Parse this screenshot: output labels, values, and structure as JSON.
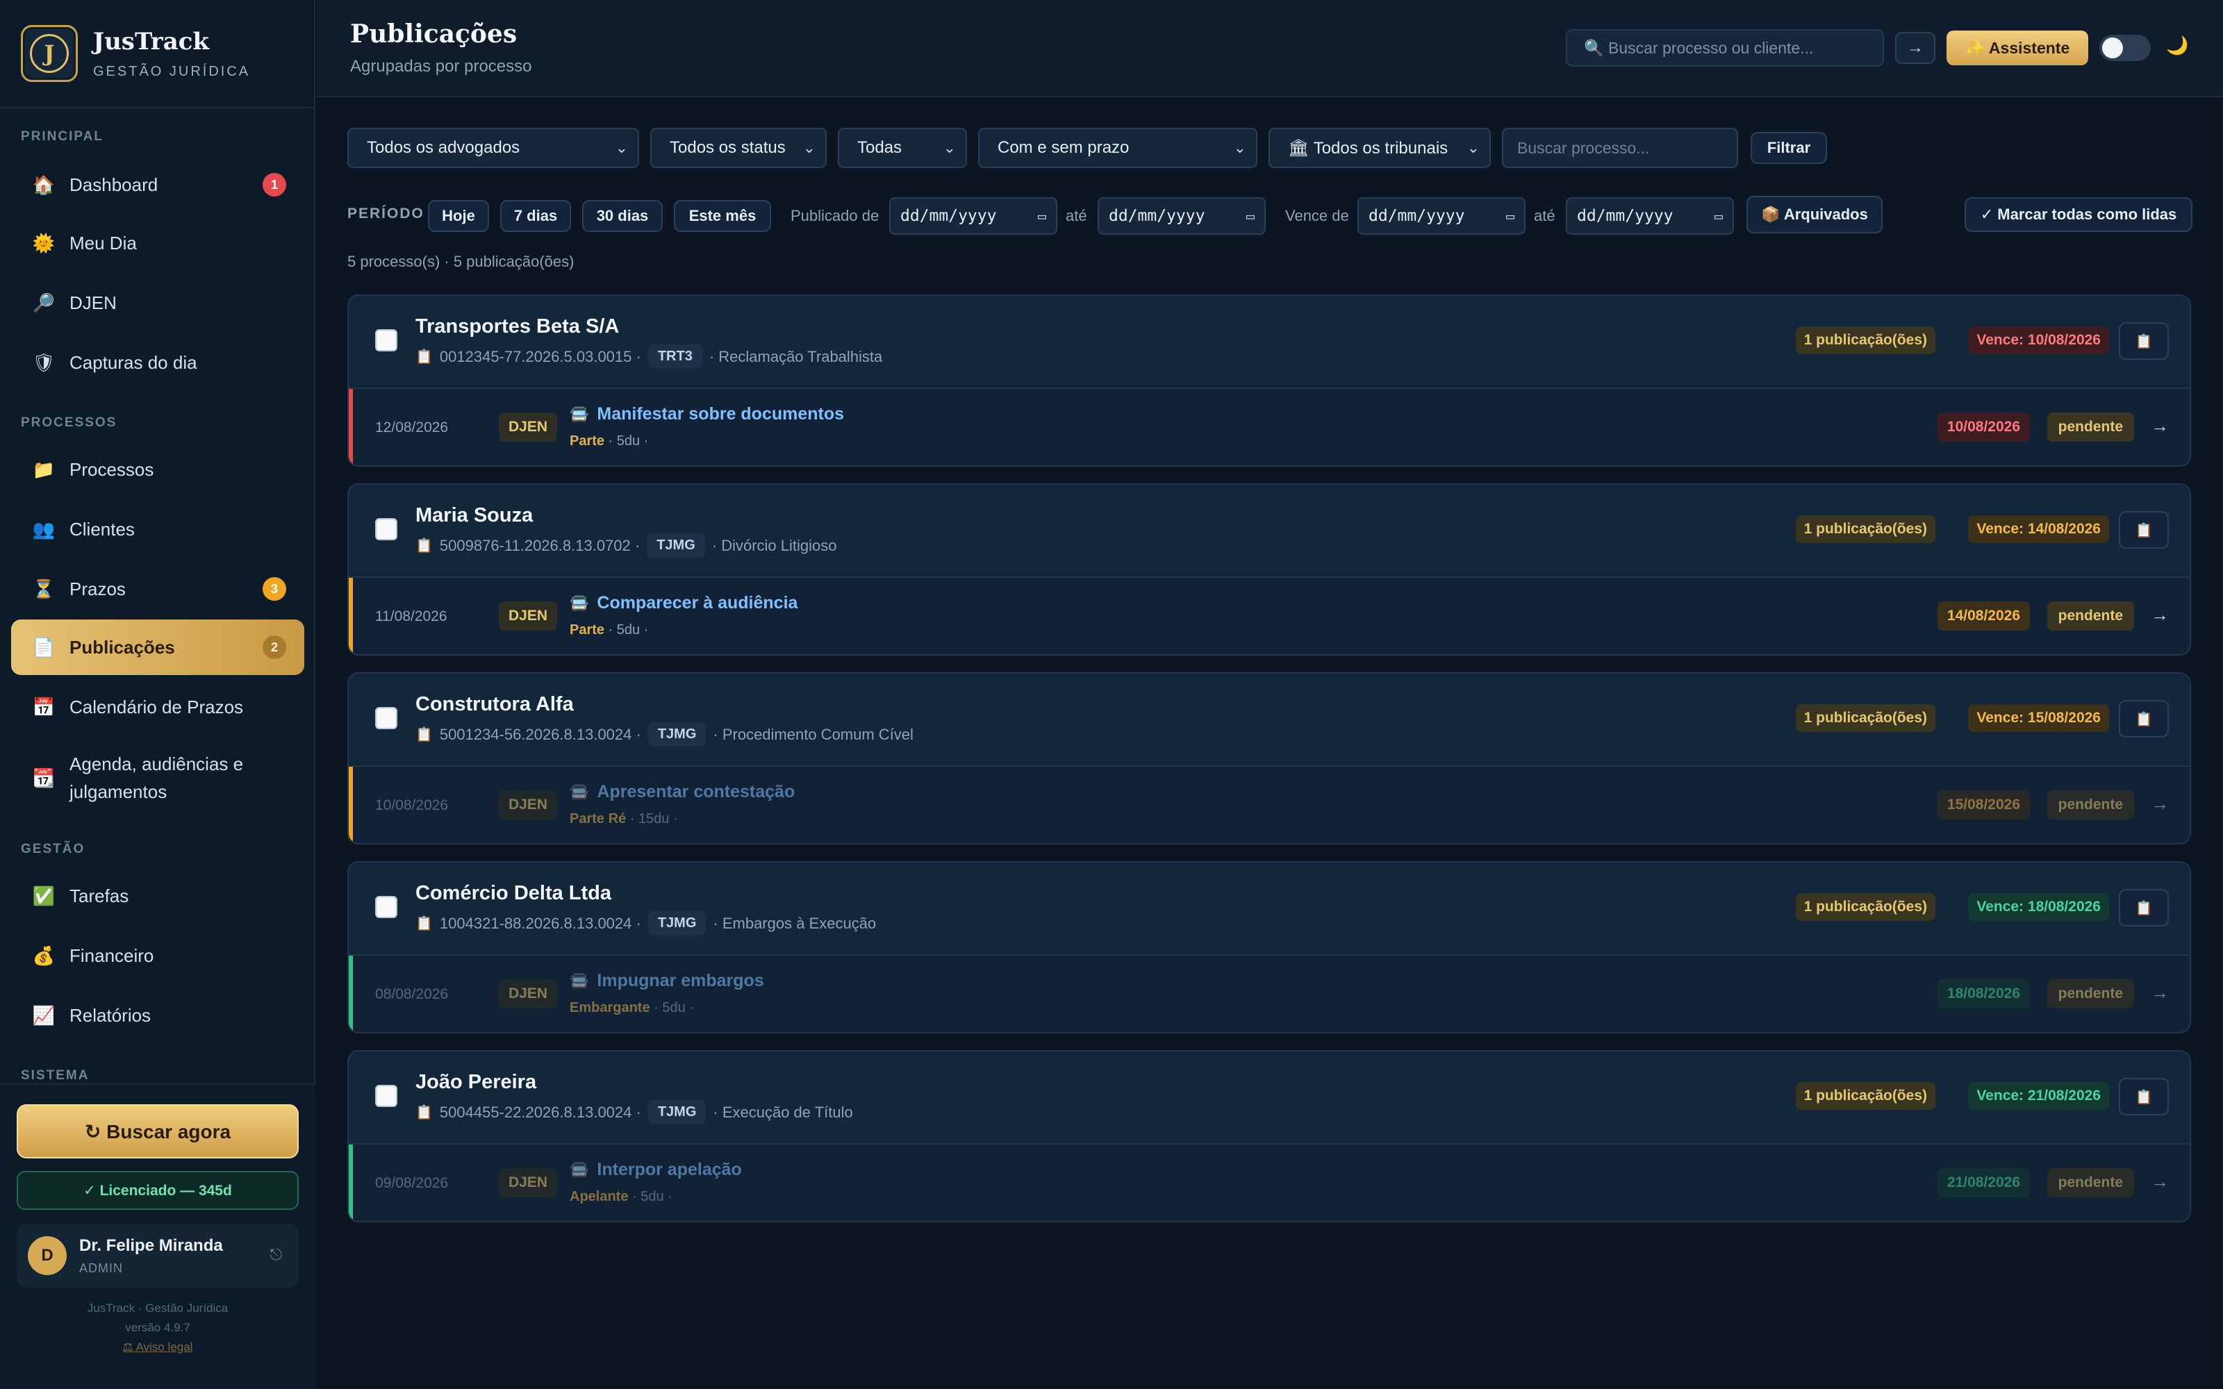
{
  "app": {
    "name": "JusTrack",
    "subtitle": "GESTÃO JURÍDICA",
    "logo_letter": "J"
  },
  "sidebar": {
    "sections": [
      {
        "label": "PRINCIPAL"
      },
      {
        "label": "PROCESSOS"
      },
      {
        "label": "GESTÃO"
      },
      {
        "label": "SISTEMA"
      }
    ],
    "items": [
      {
        "label": "Dashboard",
        "icon": "🏠",
        "badge": "1"
      },
      {
        "label": "Meu Dia",
        "icon": "🌞"
      },
      {
        "label": "DJEN",
        "icon": "🔎"
      },
      {
        "label": "Capturas do dia",
        "icon": "🛡"
      },
      {
        "label": "Processos",
        "icon": "📁"
      },
      {
        "label": "Clientes",
        "icon": "👥"
      },
      {
        "label": "Prazos",
        "icon": "⏳",
        "badge": "3"
      },
      {
        "label": "Publicações",
        "icon": "📄",
        "badge": "2"
      },
      {
        "label": "Calendário de Prazos",
        "icon": "📅"
      },
      {
        "label": "Agenda, audiências e julgamentos",
        "icon": "📆"
      },
      {
        "label": "Tarefas",
        "icon": "✅"
      },
      {
        "label": "Financeiro",
        "icon": "💰"
      },
      {
        "label": "Relatórios",
        "icon": "📈"
      }
    ],
    "search_button": "↻  Buscar agora",
    "license": "✓ Licenciado — 345d",
    "user": {
      "initial": "D",
      "name": "Dr. Felipe Miranda",
      "role": "ADMIN",
      "logout_icon": "⎋"
    },
    "footer": {
      "line1": "JusTrack · Gestão Jurídica",
      "line2": "versão 4.9.7",
      "legal": "⚖ Aviso legal"
    }
  },
  "header": {
    "title": "Publicações",
    "subtitle": "Agrupadas por processo",
    "search_placeholder": "🔍 Buscar processo ou cliente...",
    "go": "→",
    "assistant": "✨ Assistente",
    "theme_icon": "🌙"
  },
  "filters": {
    "advogados": "Todos os advogados",
    "status": "Todos os status",
    "todas": "Todas",
    "prazo": "Com e sem prazo",
    "tribunais": "🏛 Todos os tribunais",
    "search_placeholder": "Buscar processo...",
    "filter_button": "Filtrar",
    "period_label": "PERÍODO",
    "period_buttons": [
      "Hoje",
      "7 dias",
      "30 dias",
      "Este mês"
    ],
    "published_from": "Publicado de",
    "until": "até",
    "due_from": "Vence de",
    "date_placeholder": "dd/mm/yyyy",
    "archived": "📦 Arquivados",
    "mark_all": "✓ Marcar todas como lidas",
    "counts": "5 processo(s) · 5 publicação(ões)"
  },
  "colors": {
    "red": "#e5484d",
    "orange": "#f0a623",
    "green": "#2fbf8a",
    "gold": "#d5a651"
  },
  "cards": [
    {
      "client": "Transportes Beta S/A",
      "process": "0012345-77.2026.5.03.0015 ·",
      "court": "TRT3",
      "type": "· Reclamação Trabalhista",
      "pub_count": "1 publicação(ões)",
      "vence": "Vence: 10/08/2026",
      "date": "12/08/2026",
      "source": "DJEN",
      "title": "Manifestar sobre documentos",
      "role": "Parte",
      "meta": " · 5du ·",
      "due": "10/08/2026",
      "status": "pendente",
      "urgency": "red"
    },
    {
      "client": "Maria Souza",
      "process": "5009876-11.2026.8.13.0702 ·",
      "court": "TJMG",
      "type": "· Divórcio Litigioso",
      "pub_count": "1 publicação(ões)",
      "vence": "Vence: 14/08/2026",
      "date": "11/08/2026",
      "source": "DJEN",
      "title": "Comparecer à audiência",
      "role": "Parte",
      "meta": " · 5du ·",
      "due": "14/08/2026",
      "status": "pendente",
      "urgency": "orange"
    },
    {
      "client": "Construtora Alfa",
      "process": "5001234-56.2026.8.13.0024 ·",
      "court": "TJMG",
      "type": "· Procedimento Comum Cível",
      "pub_count": "1 publicação(ões)",
      "vence": "Vence: 15/08/2026",
      "date": "10/08/2026",
      "source": "DJEN",
      "title": "Apresentar contestação",
      "role": "Parte Ré",
      "meta": " · 15du ·",
      "due": "15/08/2026",
      "status": "pendente",
      "urgency": "orange"
    },
    {
      "client": "Comércio Delta Ltda",
      "process": "1004321-88.2026.8.13.0024 ·",
      "court": "TJMG",
      "type": "· Embargos à Execução",
      "pub_count": "1 publicação(ões)",
      "vence": "Vence: 18/08/2026",
      "date": "08/08/2026",
      "source": "DJEN",
      "title": "Impugnar embargos",
      "role": "Embargante",
      "meta": " · 5du ·",
      "due": "18/08/2026",
      "status": "pendente",
      "urgency": "green"
    },
    {
      "client": "João Pereira",
      "process": "5004455-22.2026.8.13.0024 ·",
      "court": "TJMG",
      "type": "· Execução de Título",
      "pub_count": "1 publicação(ões)",
      "vence": "Vence: 21/08/2026",
      "date": "09/08/2026",
      "source": "DJEN",
      "title": "Interpor apelação",
      "role": "Apelante",
      "meta": " · 5du ·",
      "due": "21/08/2026",
      "status": "pendente",
      "urgency": "green"
    }
  ]
}
